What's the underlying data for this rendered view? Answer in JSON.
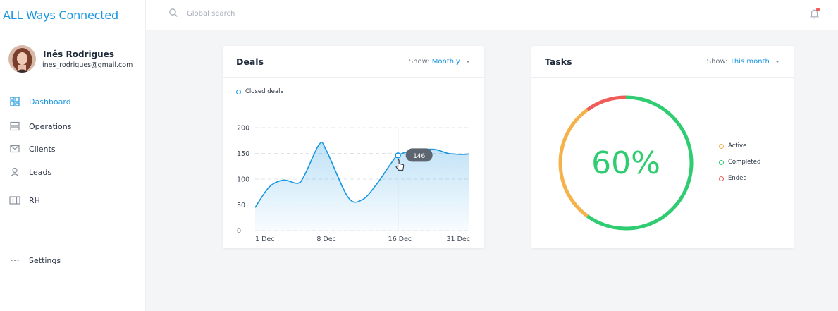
{
  "app": {
    "brand": "ALL Ways Connected"
  },
  "user": {
    "name": "Inês Rodrigues",
    "email": "ines_rodrigues@gmail.com"
  },
  "nav": {
    "items": [
      {
        "label": "Dashboard",
        "icon": "dashboard-icon",
        "active": true
      },
      {
        "label": "Operations",
        "icon": "operations-icon",
        "active": false
      },
      {
        "label": "Clients",
        "icon": "mail-icon",
        "active": false
      },
      {
        "label": "Leads",
        "icon": "user-icon",
        "active": false
      },
      {
        "label": "RH",
        "icon": "columns-icon",
        "active": false
      }
    ],
    "settings": {
      "label": "Settings",
      "icon": "more-icon"
    }
  },
  "topbar": {
    "search_placeholder": "Global search",
    "notifications_unread": true
  },
  "deals": {
    "title": "Deals",
    "show_label": "Show:",
    "show_value": "Monthly",
    "tooltip": "146"
  },
  "tasks": {
    "title": "Tasks",
    "show_label": "Show:",
    "show_value": "This month",
    "percent_label": "60%",
    "legend": [
      {
        "label": "Active",
        "color": "#f6b24a"
      },
      {
        "label": "Completed",
        "color": "#2fcc71"
      },
      {
        "label": "Ended",
        "color": "#ef5d58"
      }
    ]
  },
  "colors": {
    "accent": "#1a96e0",
    "green": "#2fcc71",
    "orange": "#f6b24a",
    "red": "#ef5d58"
  },
  "chart_data": [
    {
      "type": "area",
      "series": [
        {
          "name": "Closed deals",
          "x": [
            0,
            2,
            4,
            6,
            7,
            9,
            10,
            13,
            15,
            17,
            19,
            20,
            22,
            25,
            27,
            29,
            30
          ],
          "values": [
            45,
            85,
            98,
            92,
            110,
            168,
            155,
            65,
            60,
            90,
            130,
            146,
            155,
            158,
            150,
            148,
            149
          ]
        }
      ],
      "x_tick_labels": [
        "1 Dec",
        "8 Dec",
        "16 Dec",
        "31 Dec"
      ],
      "xlim": [
        0,
        30
      ],
      "y_ticks": [
        0,
        50,
        100,
        150,
        200
      ],
      "ylim": [
        0,
        200
      ],
      "grid": true,
      "legend": "top-left",
      "highlight": {
        "x": 20,
        "value": 146
      }
    },
    {
      "type": "pie",
      "donut": true,
      "slices": [
        {
          "label": "Completed",
          "value": 60
        },
        {
          "label": "Active",
          "value": 30
        },
        {
          "label": "Ended",
          "value": 10
        }
      ]
    }
  ]
}
